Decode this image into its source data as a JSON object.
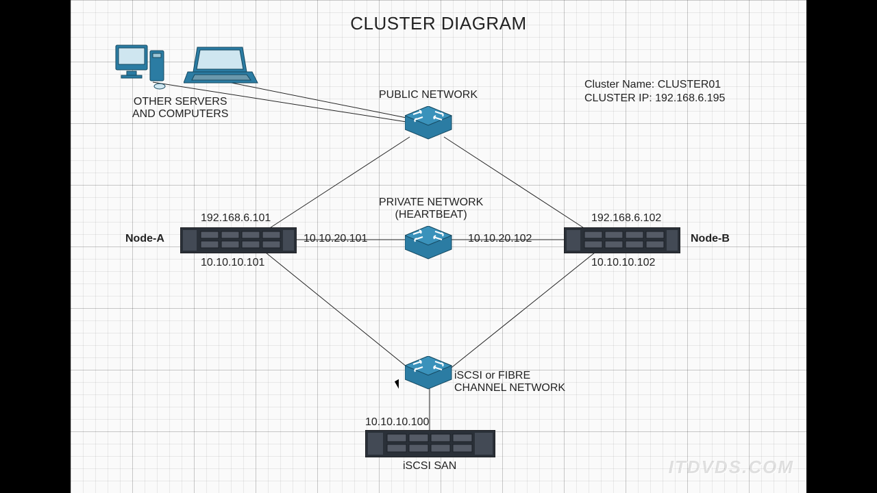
{
  "title": "CLUSTER DIAGRAM",
  "info": {
    "cluster_name_label": "Cluster Name: CLUSTER01",
    "cluster_ip_label": "CLUSTER IP: 192.168.6.195"
  },
  "labels": {
    "other_servers": "OTHER SERVERS\nAND COMPUTERS",
    "public_network": "PUBLIC NETWORK",
    "private_network": "PRIVATE NETWORK\n(HEARTBEAT)",
    "storage_network": "iSCSI or FIBRE\nCHANNEL NETWORK",
    "iscsi_san": "iSCSI SAN"
  },
  "nodes": {
    "a": {
      "name": "Node-A",
      "public_ip": "192.168.6.101",
      "private_ip": "10.10.20.101",
      "storage_ip": "10.10.10.101"
    },
    "b": {
      "name": "Node-B",
      "public_ip": "192.168.6.102",
      "private_ip": "10.10.20.102",
      "storage_ip": "10.10.10.102"
    }
  },
  "san": {
    "ip": "10.10.10.100"
  },
  "watermark": "ITDVDS.COM",
  "colors": {
    "cisco": "#2b7ca3",
    "device_dark": "#2a3038",
    "device_mid": "#434a55"
  }
}
